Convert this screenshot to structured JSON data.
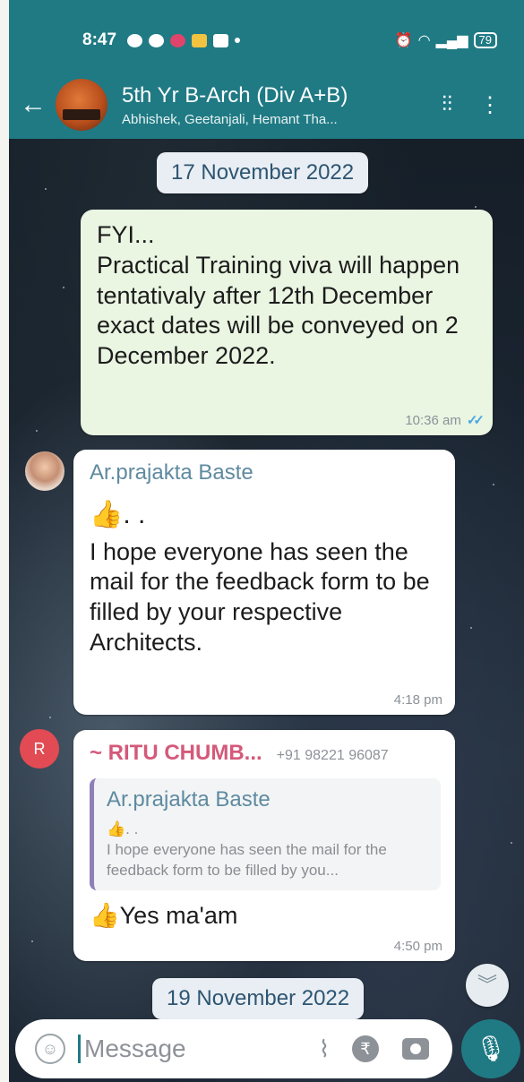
{
  "status_bar": {
    "time": "8:47",
    "battery": "79"
  },
  "header": {
    "group_name": "5th Yr B-Arch (Div A+B)",
    "members": "Abhishek, Geetanjali, Hemant Tha..."
  },
  "dates": [
    "17 November 2022",
    "19 November 2022"
  ],
  "messages": [
    {
      "direction": "out",
      "text": "FYI...\nPractical Training viva will happen tentativaly after 12th December\nexact dates will be conveyed on 2 December 2022.",
      "time": "10:36 am"
    },
    {
      "direction": "in",
      "sender": "Ar.prajakta Baste",
      "emoji": "👍. .",
      "text": "I hope everyone has seen the mail for the feedback form to be filled by your respective Architects.",
      "time": "4:18 pm"
    },
    {
      "direction": "in",
      "avatar_letter": "R",
      "sender": "~ RITU CHUMB...",
      "phone": "+91 98221 96087",
      "quote": {
        "sender": "Ar.prajakta Baste",
        "emoji": "👍. .",
        "text": "I hope everyone has seen the mail for the feedback form to be filled by you..."
      },
      "text": "👍Yes ma'am",
      "time": "4:50 pm"
    }
  ],
  "input": {
    "placeholder": "Message"
  },
  "icons": {
    "back": "back-arrow-icon",
    "call": "voice-call-icon",
    "menu": "more-vert-icon",
    "emoji": "emoji-icon",
    "attach": "paperclip-icon",
    "payment": "rupee-icon",
    "camera": "camera-icon",
    "mic": "mic-icon",
    "scroll": "chevron-double-down-icon"
  },
  "colors": {
    "header": "#1f7a84",
    "outgoing_bubble": "#eaf5e2",
    "incoming_bubble": "#ffffff",
    "read_ticks": "#4aa6e0"
  }
}
